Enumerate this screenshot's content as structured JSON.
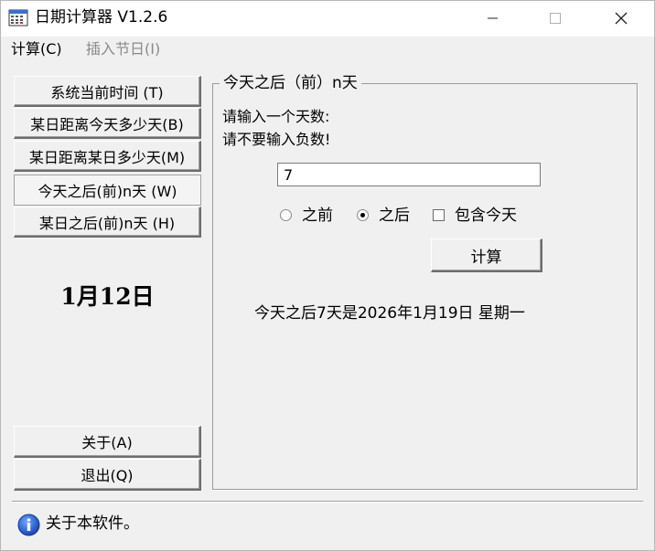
{
  "window": {
    "title": "日期计算器  V1.2.6"
  },
  "menu": {
    "calc": "计算(C)",
    "holiday": "插入节日(I)"
  },
  "nav": {
    "items": [
      {
        "label": "系统当前时间    (T)",
        "active": false
      },
      {
        "label": "某日距离今天多少天(B)",
        "active": false
      },
      {
        "label": "某日距离某日多少天(M)",
        "active": false
      },
      {
        "label": "今天之后(前)n天   (W)",
        "active": true
      },
      {
        "label": "某日之后(前)n天   (H)",
        "active": false
      }
    ]
  },
  "date_display": "1月12日",
  "buttons": {
    "about": "关于(A)",
    "exit": "退出(Q)",
    "calculate": "计算"
  },
  "group": {
    "title": "今天之后（前）n天",
    "prompt_line1": "请输入一个天数:",
    "prompt_line2": "请不要输入负数!",
    "days_value": "7",
    "option_before": "之前",
    "option_after": "之后",
    "option_include_today": "包含今天",
    "selected_option": "after",
    "include_today_checked": false,
    "result": "今天之后7天是2026年1月19日  星期一"
  },
  "status": {
    "text": "关于本软件。",
    "icon": "info-icon"
  }
}
